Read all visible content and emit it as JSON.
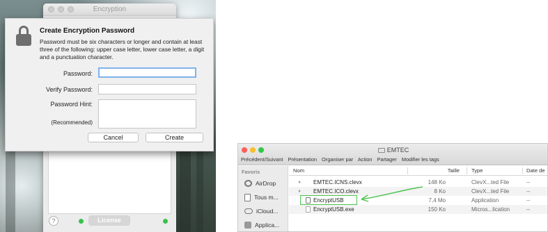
{
  "encryption_app": {
    "window_title": "Encryption",
    "help_label": "?",
    "license_label": "License",
    "sheet": {
      "title": "Create Encryption Password",
      "description": "Password must be six characters or longer and contain at least three of the following: upper case letter, lower case letter, a digit and a punctuation character.",
      "password_label": "Password:",
      "password_value": "",
      "verify_label": "Verify Password:",
      "verify_value": "",
      "hint_label": "Password Hint:",
      "hint_sublabel": "(Recommended)",
      "hint_value": "",
      "cancel_label": "Cancel",
      "create_label": "Create"
    }
  },
  "finder": {
    "title": "EMTEC",
    "toolbar": [
      "Précédent/Suivant",
      "Présentation",
      "Organiser par",
      "Action",
      "Partager",
      "Modifier les tags"
    ],
    "sidebar": {
      "heading": "Favoris",
      "items": [
        {
          "label": "AirDrop",
          "icon": "airdrop-icon"
        },
        {
          "label": "Tous m...",
          "icon": "all-files-icon"
        },
        {
          "label": "iCloud...",
          "icon": "icloud-icon"
        },
        {
          "label": "Applica...",
          "icon": "applications-icon"
        }
      ]
    },
    "columns": {
      "name": "Nom",
      "size": "Taille",
      "type": "Type",
      "date": "Date de"
    },
    "files": [
      {
        "name": "EMTEC.ICNS.clevx",
        "size": "148 Ko",
        "type": "ClevX...ted File",
        "date": "--"
      },
      {
        "name": "EMTEC.ICO.clevx",
        "size": "8 Ko",
        "type": "ClevX...ted File",
        "date": "--"
      },
      {
        "name": "EncryptUSB",
        "size": "7,4 Mo",
        "type": "Application",
        "date": "--"
      },
      {
        "name": "EncryptUSB.exe",
        "size": "150 Ko",
        "type": "Micros...lication",
        "date": "--"
      }
    ],
    "highlighted_file": "EncryptUSB",
    "highlight_color": "#4bc34b"
  },
  "colors": {
    "close": "#fc5f57",
    "minimize": "#fdbc2e",
    "zoom": "#33c748",
    "focus_ring": "#7fb3ea",
    "status_led": "#39c14a"
  }
}
